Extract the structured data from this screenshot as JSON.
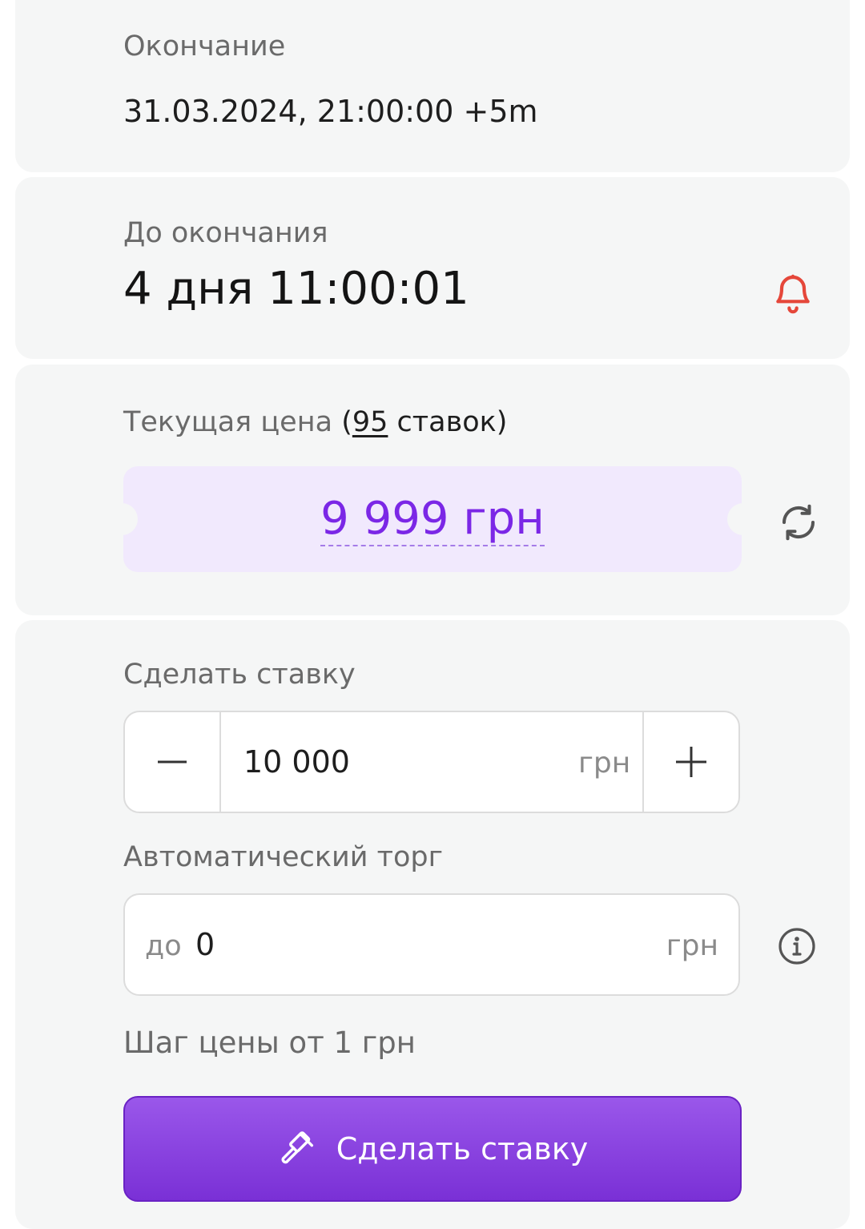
{
  "end": {
    "label": "Окончание",
    "value": "31.03.2024, 21:00:00 +5m"
  },
  "countdown": {
    "label": "До окончания",
    "value": "4 дня 11:00:01",
    "bell_icon": "bell-icon"
  },
  "current_price": {
    "label": "Текущая цена",
    "bids_open": "(",
    "bids_count": "95",
    "bids_suffix": " ставок)",
    "value": "9 999 грн",
    "refresh_icon": "refresh-icon"
  },
  "bid": {
    "label": "Сделать ставку",
    "amount": "10 000",
    "unit": "грн",
    "decrement_icon": "minus-icon",
    "increment_icon": "plus-icon"
  },
  "auto_bid": {
    "label": "Автоматический торг",
    "prefix": "до",
    "value": "0",
    "unit": "грн",
    "info_icon": "info-icon"
  },
  "step_text": "Шаг цены от 1 грн",
  "submit": {
    "label": "Сделать ставку",
    "icon": "gavel-icon"
  },
  "colors": {
    "accent": "#7b27e6",
    "bell": "#e5473a",
    "card_bg": "#f5f6f6"
  }
}
